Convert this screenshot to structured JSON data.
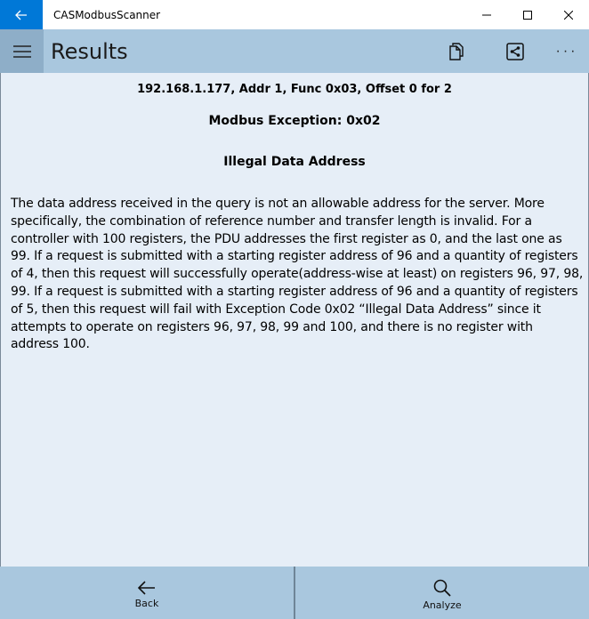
{
  "window": {
    "title": "CASModbusScanner",
    "controls": [
      "minimize",
      "maximize",
      "close"
    ]
  },
  "appbar": {
    "page_title": "Results",
    "actions": [
      {
        "name": "copy",
        "icon": "copy-icon"
      },
      {
        "name": "share",
        "icon": "share-icon"
      },
      {
        "name": "more",
        "label": "···"
      }
    ]
  },
  "result": {
    "request_line": "192.168.1.177, Addr 1, Func  0x03, Offset 0 for 2",
    "exception_code": "Modbus Exception: 0x02",
    "exception_name": "Illegal Data Address",
    "description": "The data address received in the query is not an allowable address for the server.  More specifically, the combination of reference number and transfer length is invalid.  For a controller with 100 registers, the PDU addresses the first register as 0, and the last one as 99.  If a request is submitted with a starting register address of 96 and a quantity of registers of 4, then this request will successfully operate(address-wise at least) on registers 96, 97, 98, 99.  If a request is submitted with a starting register address of 96 and a quantity of registers of 5, then this request will fail with Exception Code 0x02 “Illegal Data Address” since it attempts to operate on registers 96, 97, 98, 99 and 100, and there is no register with address 100."
  },
  "bottombar": {
    "back_label": "Back",
    "analyze_label": "Analyze"
  },
  "colors": {
    "accent": "#0078d7",
    "appbar": "#a9c7de",
    "content_bg": "#e6eef7"
  }
}
